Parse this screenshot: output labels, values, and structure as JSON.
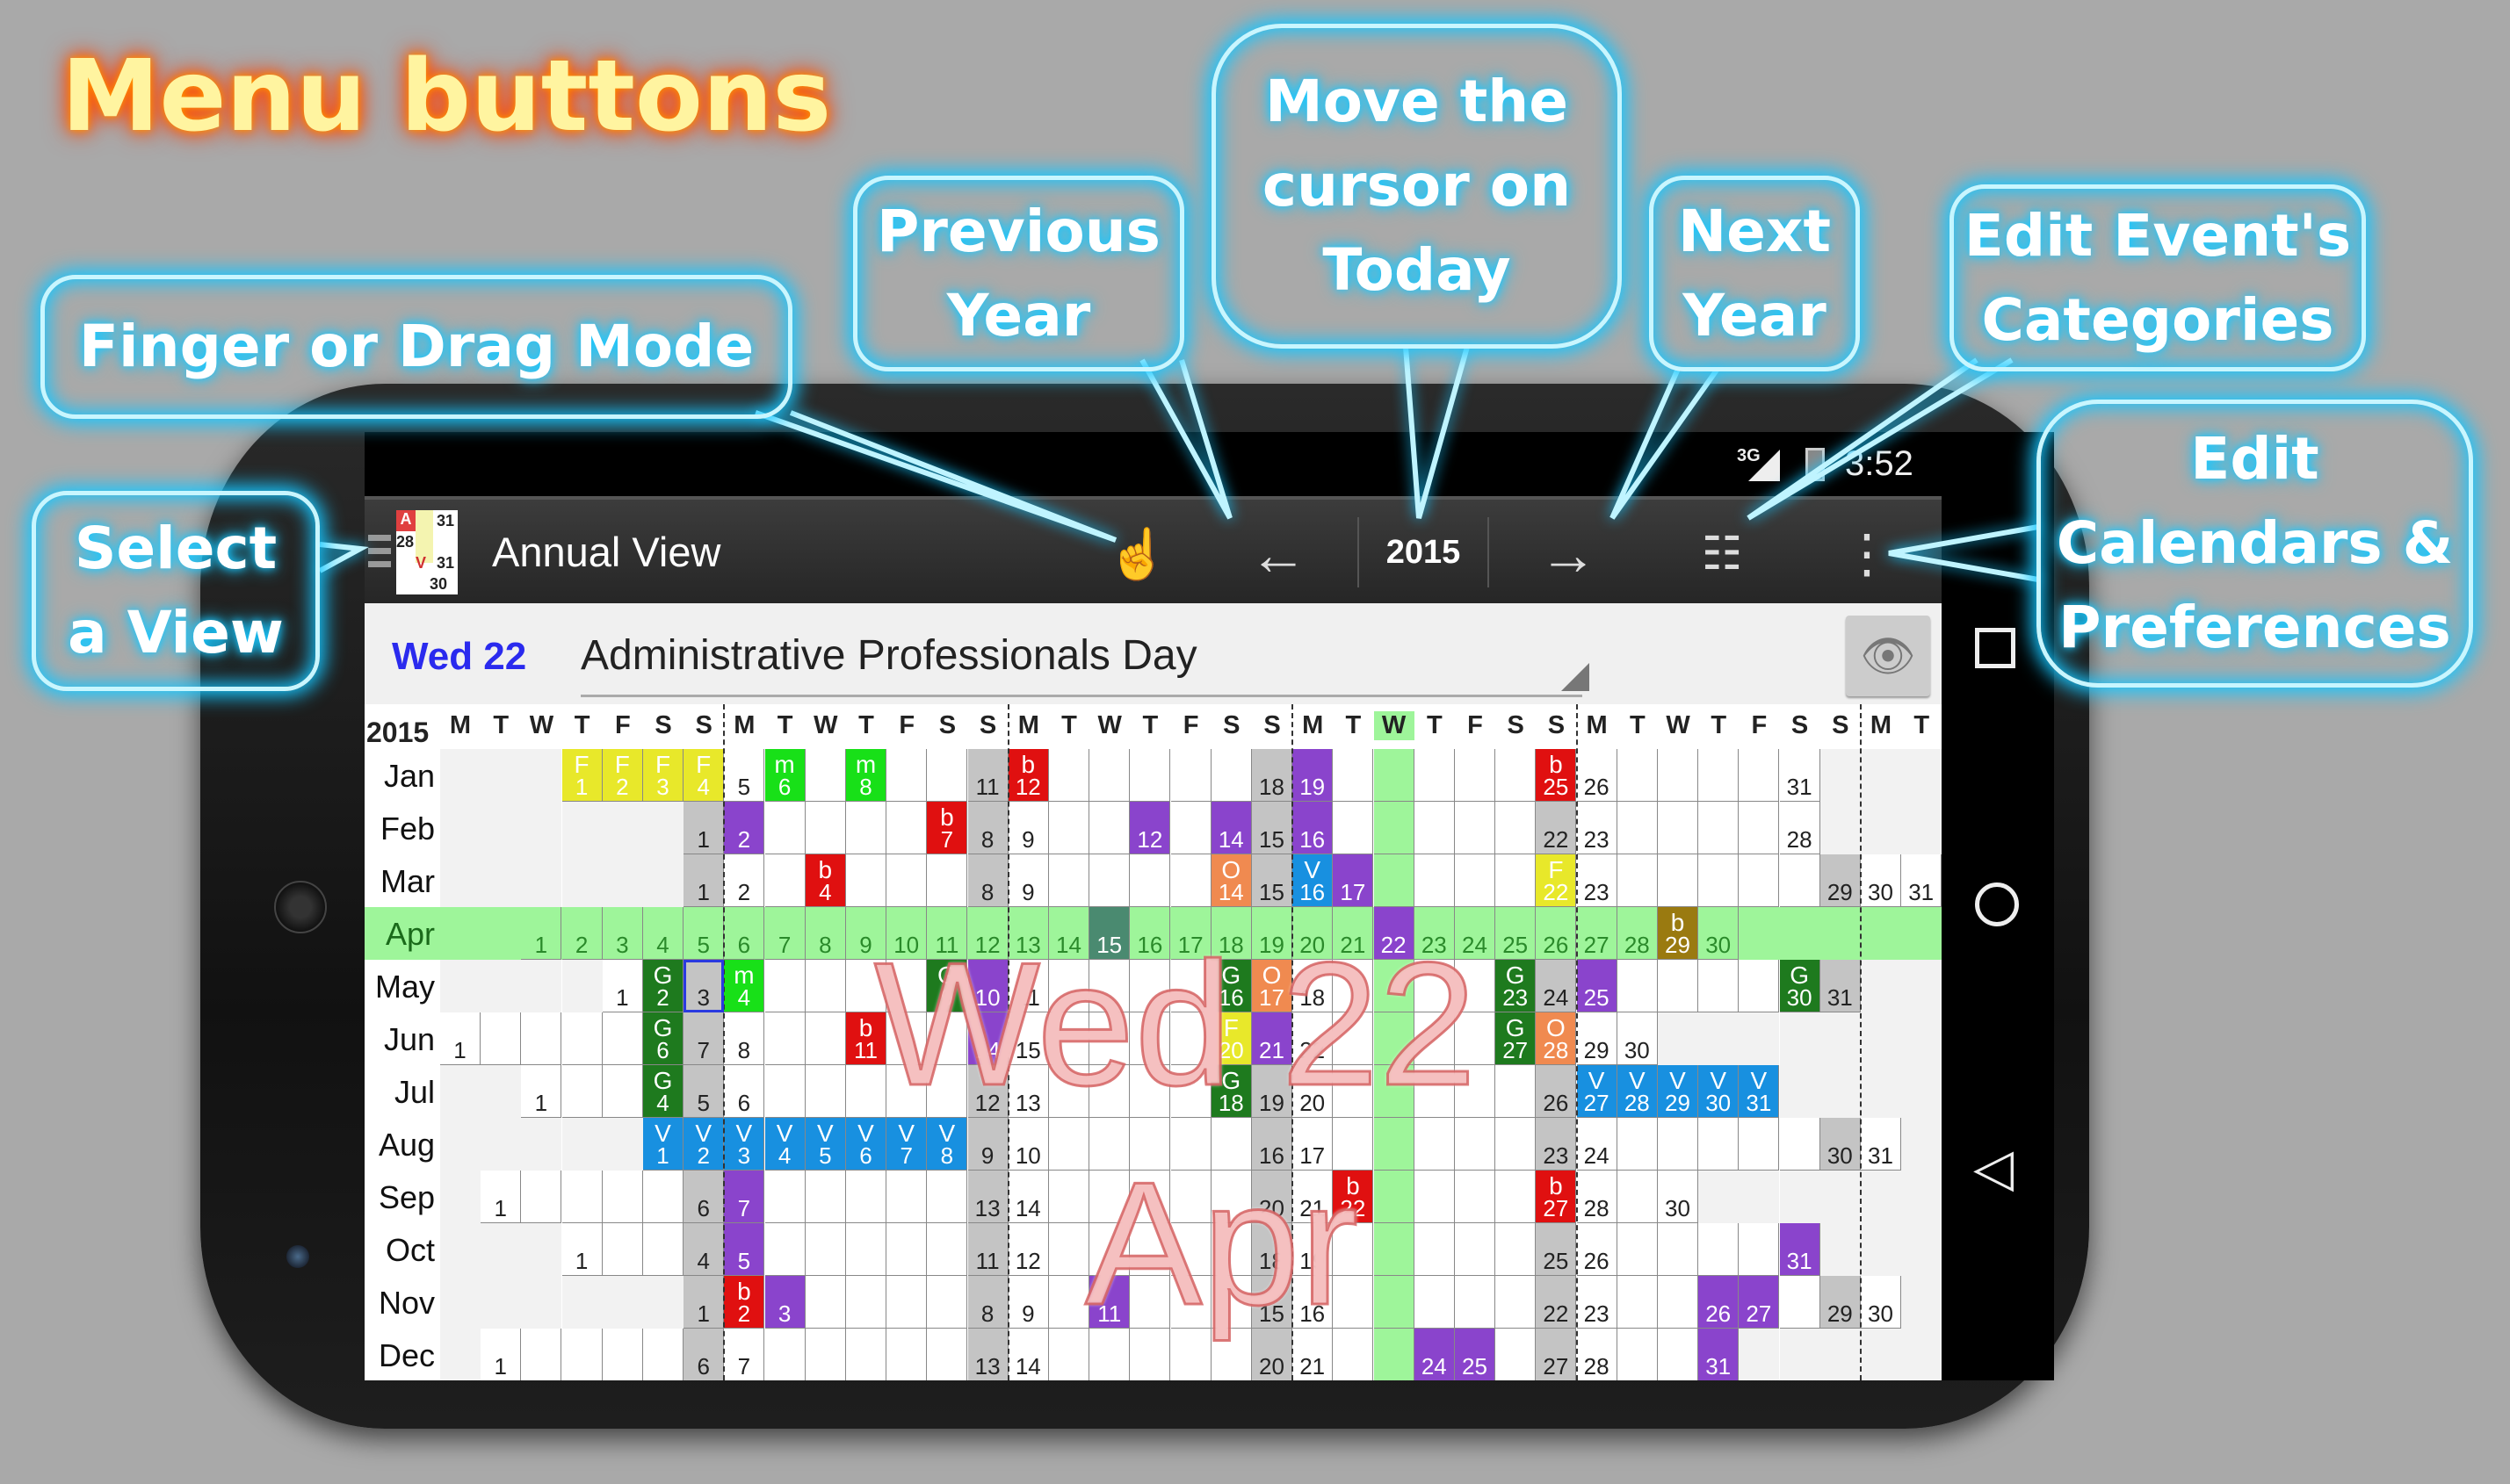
{
  "annotations": {
    "title": "Menu buttons",
    "finger_drag": "Finger or Drag Mode",
    "select_view": [
      "Select",
      "a View"
    ],
    "previous_year": [
      "Previous",
      "Year"
    ],
    "today": [
      "Move the",
      "cursor on",
      "Today"
    ],
    "next_year": [
      "Next",
      "Year"
    ],
    "categories": [
      "Edit Event's",
      "Categories"
    ],
    "preferences": [
      "Edit",
      "Calendars &",
      "Preferences"
    ]
  },
  "status": {
    "network": "3G",
    "time": "3:52"
  },
  "toolbar": {
    "title": "Annual View",
    "year": "2015",
    "view_icon": {
      "a": "A",
      "n31a": "31",
      "n28": "28",
      "v": "V",
      "n31b": "31",
      "n30": "30"
    },
    "icons": [
      "hand-icon",
      "arrow-left-icon",
      "arrow-right-icon",
      "category-list-icon",
      "overflow-menu-icon"
    ]
  },
  "info": {
    "date": "Wed  22",
    "title": "Administrative Professionals Day"
  },
  "watermark": {
    "day": "Wed 22",
    "month": "Apr"
  },
  "calendar": {
    "year": "2015",
    "weekday_headers": [
      "M",
      "T",
      "W",
      "T",
      "F",
      "S",
      "S"
    ],
    "today": {
      "month": 4,
      "day": 22
    },
    "colors": {
      "F": "#e8e82a",
      "m": "#18e018",
      "b": "#e01010",
      "P": "#8a44cc",
      "O": "#f08a50",
      "V": "#1890e0",
      "G": "#1e7a1e",
      "T": "#4a8a70",
      "B": "#9a7a10",
      "today": "#9ef59a"
    },
    "months": [
      {
        "name": "Jan",
        "offset": 3,
        "days": 31
      },
      {
        "name": "Feb",
        "offset": 6,
        "days": 28
      },
      {
        "name": "Mar",
        "offset": 6,
        "days": 31
      },
      {
        "name": "Apr",
        "offset": 2,
        "days": 30
      },
      {
        "name": "May",
        "offset": 4,
        "days": 31
      },
      {
        "name": "Jun",
        "offset": 0,
        "days": 30
      },
      {
        "name": "Jul",
        "offset": 2,
        "days": 31
      },
      {
        "name": "Aug",
        "offset": 5,
        "days": 31
      },
      {
        "name": "Sep",
        "offset": 1,
        "days": 30
      },
      {
        "name": "Oct",
        "offset": 3,
        "days": 31
      },
      {
        "name": "Nov",
        "offset": 6,
        "days": 30
      },
      {
        "name": "Dec",
        "offset": 1,
        "days": 31
      }
    ],
    "events": [
      [
        1,
        1,
        "F",
        "F"
      ],
      [
        1,
        2,
        "F",
        "F"
      ],
      [
        1,
        3,
        "F",
        "F"
      ],
      [
        1,
        4,
        "F",
        "F"
      ],
      [
        1,
        6,
        "m",
        "m"
      ],
      [
        1,
        8,
        "m",
        "m"
      ],
      [
        1,
        12,
        "b",
        "b"
      ],
      [
        1,
        19,
        "",
        "P"
      ],
      [
        1,
        25,
        "b",
        "b"
      ],
      [
        2,
        2,
        "",
        "P"
      ],
      [
        2,
        7,
        "b",
        "b"
      ],
      [
        2,
        12,
        "",
        "P"
      ],
      [
        2,
        14,
        "",
        "P"
      ],
      [
        2,
        16,
        "",
        "P"
      ],
      [
        3,
        4,
        "b",
        "b"
      ],
      [
        3,
        14,
        "O",
        "O"
      ],
      [
        3,
        16,
        "V",
        "V"
      ],
      [
        3,
        17,
        "",
        "P"
      ],
      [
        3,
        22,
        "F",
        "F"
      ],
      [
        4,
        15,
        "",
        "T"
      ],
      [
        4,
        22,
        "",
        "P"
      ],
      [
        4,
        29,
        "b",
        "B"
      ],
      [
        5,
        2,
        "G",
        "G"
      ],
      [
        5,
        4,
        "m",
        "m"
      ],
      [
        5,
        9,
        "G",
        "G"
      ],
      [
        5,
        10,
        "",
        "P"
      ],
      [
        5,
        16,
        "G",
        "G"
      ],
      [
        5,
        17,
        "O",
        "O"
      ],
      [
        5,
        23,
        "G",
        "G"
      ],
      [
        5,
        25,
        "",
        "P"
      ],
      [
        5,
        30,
        "G",
        "G"
      ],
      [
        6,
        6,
        "G",
        "G"
      ],
      [
        6,
        11,
        "b",
        "b"
      ],
      [
        6,
        14,
        "",
        "P"
      ],
      [
        6,
        20,
        "F",
        "F"
      ],
      [
        6,
        21,
        "",
        "P"
      ],
      [
        6,
        27,
        "G",
        "G"
      ],
      [
        6,
        28,
        "O",
        "O"
      ],
      [
        7,
        4,
        "G",
        "G"
      ],
      [
        7,
        18,
        "G",
        "G"
      ],
      [
        7,
        27,
        "V",
        "V"
      ],
      [
        7,
        28,
        "V",
        "V"
      ],
      [
        7,
        29,
        "V",
        "V"
      ],
      [
        7,
        30,
        "V",
        "V"
      ],
      [
        7,
        31,
        "V",
        "V"
      ],
      [
        8,
        1,
        "V",
        "V"
      ],
      [
        8,
        2,
        "V",
        "V"
      ],
      [
        8,
        3,
        "V",
        "V"
      ],
      [
        8,
        4,
        "V",
        "V"
      ],
      [
        8,
        5,
        "V",
        "V"
      ],
      [
        8,
        6,
        "V",
        "V"
      ],
      [
        8,
        7,
        "V",
        "V"
      ],
      [
        8,
        8,
        "V",
        "V"
      ],
      [
        9,
        7,
        "",
        "P"
      ],
      [
        9,
        22,
        "b",
        "b"
      ],
      [
        9,
        27,
        "b",
        "b"
      ],
      [
        10,
        5,
        "",
        "P"
      ],
      [
        10,
        31,
        "",
        "P"
      ],
      [
        11,
        2,
        "b",
        "b"
      ],
      [
        11,
        3,
        "",
        "P"
      ],
      [
        11,
        11,
        "",
        "P"
      ],
      [
        11,
        26,
        "",
        "P"
      ],
      [
        11,
        27,
        "",
        "P"
      ],
      [
        12,
        24,
        "",
        "P"
      ],
      [
        12,
        25,
        "",
        "P"
      ],
      [
        12,
        31,
        "",
        "P"
      ]
    ]
  }
}
